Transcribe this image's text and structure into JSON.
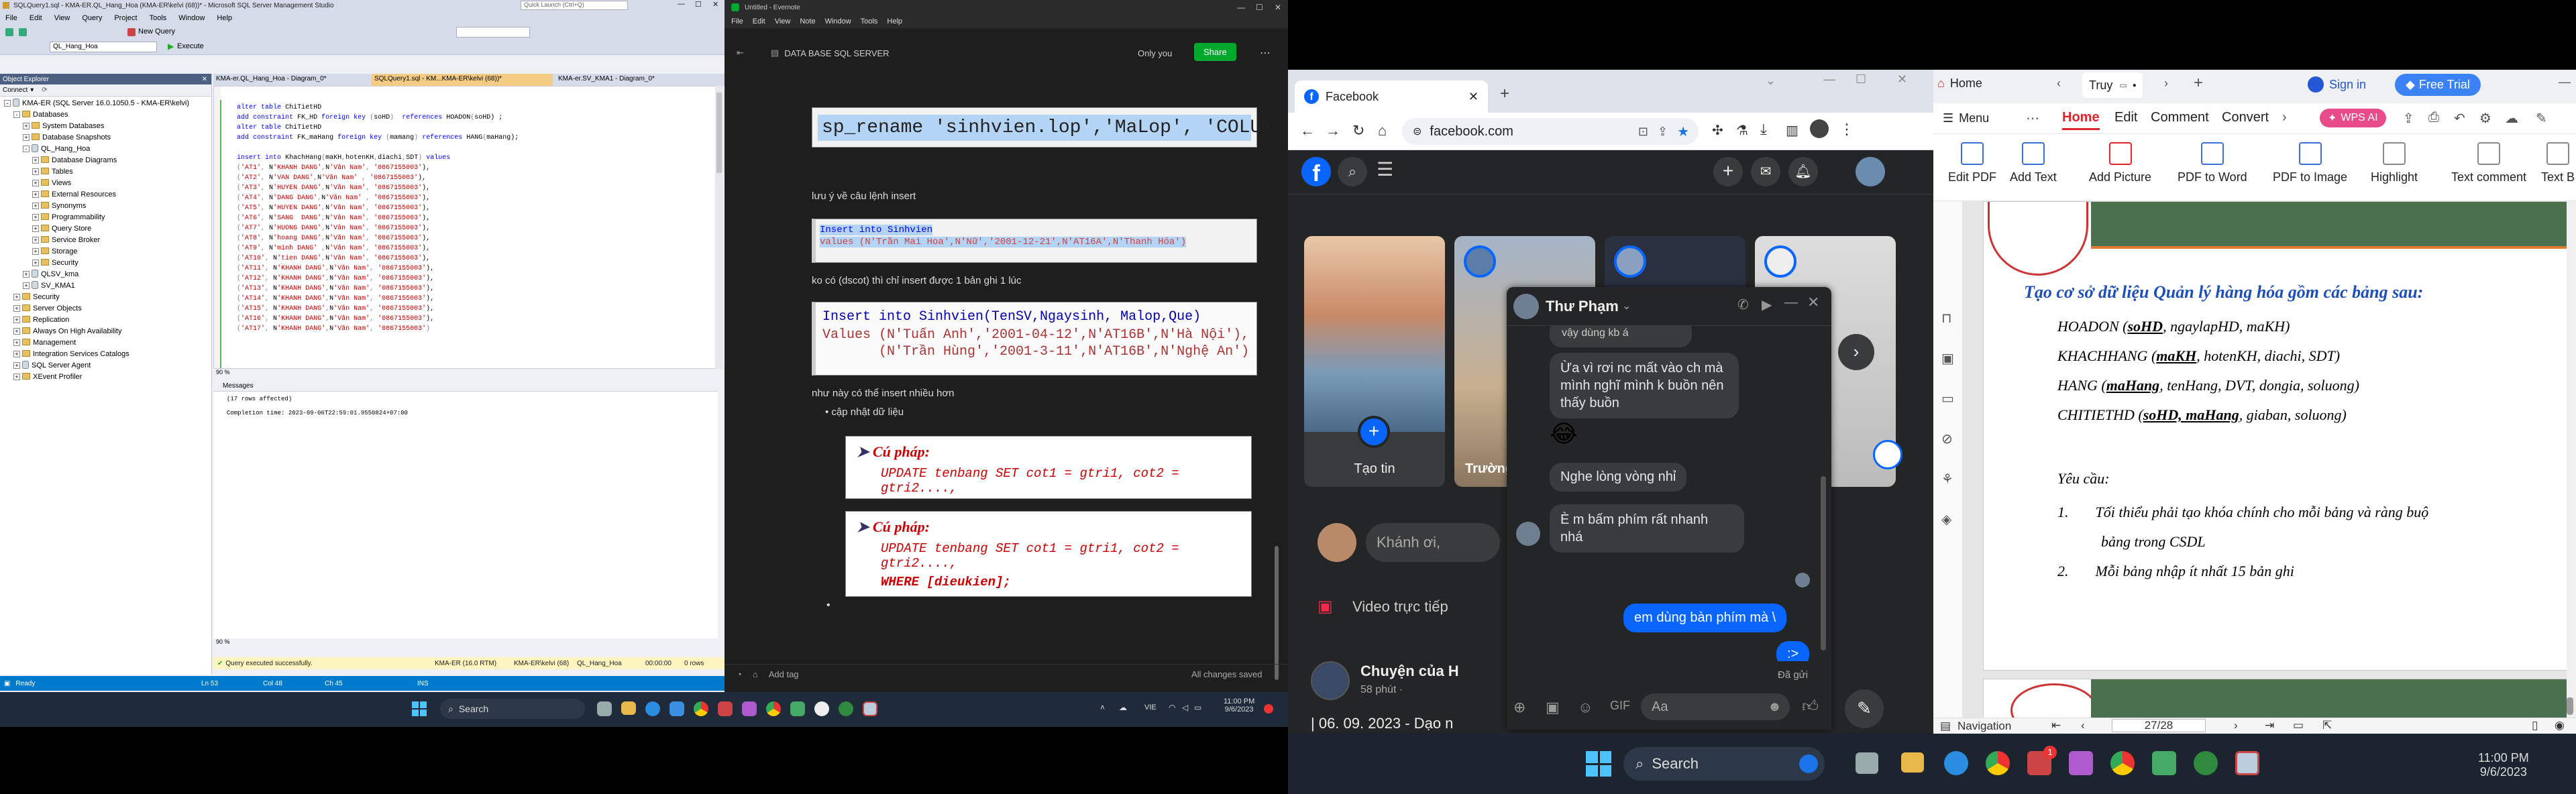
{
  "ssms": {
    "title": "SQLQuery1.sql - KMA-ER.QL_Hang_Hoa (KMA-ER\\kelvi (68))* - Microsoft SQL Server Management Studio",
    "quick_launch": "Quick Launch (Ctrl+Q)",
    "menu": [
      "File",
      "Edit",
      "View",
      "Query",
      "Project",
      "Tools",
      "Window",
      "Help"
    ],
    "toolbar": {
      "new_query": "New Query",
      "execute": "Execute",
      "database": "QL_Hang_Hoa"
    },
    "tabs": [
      "KMA-er.QL_Hang_Hoa - Diagram_0*",
      "SQLQuery1.sql - KM...KMA-ER\\kelvi (68))*",
      "KMA-er.SV_KMA1 - Diagram_0*"
    ],
    "object_explorer": {
      "title": "Object Explorer",
      "connect": "Connect",
      "items": [
        {
          "depth": 0,
          "sign": "-",
          "type": "server",
          "label": "KMA-ER (SQL Server 16.0.1050.5 - KMA-ER\\kelvi)"
        },
        {
          "depth": 1,
          "sign": "-",
          "type": "folder",
          "label": "Databases"
        },
        {
          "depth": 2,
          "sign": "+",
          "type": "folder",
          "label": "System Databases"
        },
        {
          "depth": 2,
          "sign": "+",
          "type": "folder",
          "label": "Database Snapshots"
        },
        {
          "depth": 2,
          "sign": "-",
          "type": "db",
          "label": "QL_Hang_Hoa"
        },
        {
          "depth": 3,
          "sign": "+",
          "type": "folder",
          "label": "Database Diagrams"
        },
        {
          "depth": 3,
          "sign": "+",
          "type": "folder",
          "label": "Tables"
        },
        {
          "depth": 3,
          "sign": "+",
          "type": "folder",
          "label": "Views"
        },
        {
          "depth": 3,
          "sign": "+",
          "type": "folder",
          "label": "External Resources"
        },
        {
          "depth": 3,
          "sign": "+",
          "type": "folder",
          "label": "Synonyms"
        },
        {
          "depth": 3,
          "sign": "+",
          "type": "folder",
          "label": "Programmability"
        },
        {
          "depth": 3,
          "sign": "+",
          "type": "folder",
          "label": "Query Store"
        },
        {
          "depth": 3,
          "sign": "+",
          "type": "folder",
          "label": "Service Broker"
        },
        {
          "depth": 3,
          "sign": "+",
          "type": "folder",
          "label": "Storage"
        },
        {
          "depth": 3,
          "sign": "+",
          "type": "folder",
          "label": "Security"
        },
        {
          "depth": 2,
          "sign": "+",
          "type": "db",
          "label": "QLSV_kma"
        },
        {
          "depth": 2,
          "sign": "+",
          "type": "db",
          "label": "SV_KMA1"
        },
        {
          "depth": 1,
          "sign": "+",
          "type": "folder",
          "label": "Security"
        },
        {
          "depth": 1,
          "sign": "+",
          "type": "folder",
          "label": "Server Objects"
        },
        {
          "depth": 1,
          "sign": "+",
          "type": "folder",
          "label": "Replication"
        },
        {
          "depth": 1,
          "sign": "+",
          "type": "folder",
          "label": "Always On High Availability"
        },
        {
          "depth": 1,
          "sign": "+",
          "type": "folder",
          "label": "Management"
        },
        {
          "depth": 1,
          "sign": "+",
          "type": "folder",
          "label": "Integration Services Catalogs"
        },
        {
          "depth": 1,
          "sign": "+",
          "type": "server",
          "label": "SQL Server Agent"
        },
        {
          "depth": 1,
          "sign": "+",
          "type": "folder",
          "label": "XEvent Profiler"
        }
      ]
    },
    "code": [
      "alter table ChiTietHD",
      "add constraint FK_HD foreign key (soHD)  references HOADON(soHD) ;",
      "alter table ChiTietHD",
      "add constraint FK_maHang foreign key (mamang) references HANG(maHang);",
      "",
      "insert into KhachHang(maKH,hotenKH,diachi,SDT) values",
      "('AT1', N'KHANH DANG',N'Văn Nam', '0867155003'),",
      "('AT2', N'VAN DANG',N'Văn Nam' , '0867155003'),",
      "('AT3', N'HUYEN DANG',N'Văn Nam', '0867155003'),",
      "('AT4', N'DANG DANG',N'Văn Nam' , '0867155003'),",
      "('AT5', N'HUYEN DANG',N'Văn Nam', '0867155003'),",
      "('AT6', N'SANG  DANG',N'Văn Nam', '0867155003'),",
      "('AT7', N'HUONG DANG',N'Văn Nam', '0867155003'),",
      "('AT8', N'hoang DANG',N'Văn Nam', '0867155003'),",
      "('AT9', N'minh DANG' ,N'Văn Nam', '0867155003'),",
      "('AT10', N'tien DANG',N'Văn Nam', '0867155003'),",
      "('AT11', N'KHANH DANG',N'Văn Nam', '0867155003'),",
      "('AT12', N'KHANH DANG',N'Văn Nam', '0867155003'),",
      "('AT13', N'KHANH DANG',N'Văn Nam', '0867155003'),",
      "('AT14', N'KHANH DANG',N'Văn Nam', '0867155003'),",
      "('AT15', N'KHANH DANG',N'Văn Nam', '0867155003'),",
      "('AT16', N'KHANH DANG',N'Văn Nam', '0867155003'),",
      "('AT17', N'KHANH DANG',N'Văn Nam', '0867155003')"
    ],
    "zoom": "90 %",
    "messages_tab": "Messages",
    "messages": [
      "(17 rows affected)",
      "",
      "Completion time: 2023-09-06T22:59:01.9550824+07:00"
    ],
    "status_ok": "Query executed successfully.",
    "status_server": "KMA-ER (16.0 RTM)",
    "status_user": "KMA-ER\\kelvi (68)",
    "status_db": "QL_Hang_Hoa",
    "status_time": "00:00:00",
    "status_rows": "0 rows",
    "bottom": {
      "ready": "Ready",
      "ln": "Ln 53",
      "col": "Col 48",
      "ch": "Ch 45",
      "ins": "INS"
    }
  },
  "taskbar_left": {
    "search": "Search",
    "time": "11:00 PM",
    "date": "9/6/2023",
    "lang": "VIE"
  },
  "evernote": {
    "title": "Untitled - Evernote",
    "menu": [
      "File",
      "Edit",
      "View",
      "Note",
      "Window",
      "Tools",
      "Help"
    ],
    "notebook": "DATA BASE SQL SERVER",
    "only_you": "Only you",
    "share": "Share",
    "code1": "sp_rename 'sinhvien.lop','MaLop', 'COLUMN'",
    "note1": "lưu ý về câu lệnh insert",
    "code2a": "Insert into Sinhvien",
    "code2b": "values (N'Trần Mai Hoa',N'Nữ','2001-12-21',N'AT16A',N'Thanh Hóa')",
    "note2": "ko có (dscot) thì chỉ insert được 1 bản ghi 1 lúc",
    "code3a": "Insert into Sinhvien(TenSV,Ngaysinh, Malop,Que)",
    "code3b": "Values (N'Tuấn Anh','2001-04-12',N'AT16B',N'Hà Nội'),",
    "code3c": "       (N'Trần Hùng','2001-3-11',N'AT16B',N'Nghệ An')",
    "note3": "như này có thể insert nhiều hơn",
    "bullet": "cập nhật dữ liệu",
    "syntax_label": "Cú pháp:",
    "syntax1": "UPDATE tenbang SET cot1 = gtri1, cot2 = gtri2....,",
    "syntax2a": "UPDATE tenbang SET cot1 = gtri1, cot2 = gtri2....,",
    "syntax2b": "WHERE [dieukien];",
    "add_tag": "Add tag",
    "saved": "All changes saved"
  },
  "facebook": {
    "tab": "Facebook",
    "url": "facebook.com",
    "story_create": "Tạo tin",
    "story_2": "Trường",
    "composer_placeholder": "Khánh ơi,",
    "live_video": "Video trực tiếp",
    "post_author": "Chuyện của H",
    "post_meta": "58 phút ·",
    "post_text": "| 06. 09. 2023 - Dạo n"
  },
  "messenger": {
    "name": "Thư Phạm",
    "msgs": [
      {
        "side": "in",
        "text": "vậy dùng kb á"
      },
      {
        "side": "in",
        "text": "Ừa vì rơi nc mất vào ch mà mình nghĩ mình k buồn nên thấy buồn"
      },
      {
        "side": "in",
        "text": "😂"
      },
      {
        "side": "in",
        "text": "Nghe lòng vòng nhỉ"
      },
      {
        "side": "in",
        "text": "È m bấm phím rất nhanh nhá"
      },
      {
        "side": "out",
        "text": "em dùng bàn phím mà \\"
      },
      {
        "side": "out",
        "text": ":>"
      }
    ],
    "sent": "Đã gửi",
    "input_placeholder": "Aa"
  },
  "pdf": {
    "tab_home": "Home",
    "tab_2": "Truy",
    "signin": "Sign in",
    "trial": "Free Trial",
    "menu": "Menu",
    "ribbon_tabs": [
      "Home",
      "Edit",
      "Comment",
      "Convert"
    ],
    "wps_ai": "WPS AI",
    "tools": [
      "Edit PDF",
      "Add Text",
      "Add Picture",
      "PDF to Word",
      "PDF to Image",
      "Highlight",
      "Text comment",
      "Text B"
    ],
    "heading": "Tạo cơ sở dữ liệu Quản lý hàng hóa gồm các bảng sau:",
    "tables": [
      {
        "name": "HOADON",
        "keys": "soHD",
        "rest": ", ngaylapHD, maKH)"
      },
      {
        "name": "KHACHHANG",
        "keys": "maKH",
        "rest": ", hotenKH, diachi, SDT)"
      },
      {
        "name": "HANG",
        "keys": "maHang",
        "rest": ", tenHang, DVT, dongia, soluong)"
      },
      {
        "name": "CHITIETHD",
        "keys": "soHD, maHang",
        "rest": ", giaban, soluong)"
      }
    ],
    "req_title": "Yêu cầu:",
    "req": [
      "Tối thiểu phải tạo khóa chính cho mỗi bảng và ràng buộ",
      "bảng trong CSDL",
      "Mỗi bảng nhập ít nhất 15 bản ghi"
    ],
    "nav": "Navigation",
    "page": "27/28"
  },
  "taskbar_right": {
    "search": "Search",
    "time": "11:00 PM",
    "date": "9/6/2023",
    "badge": "1"
  },
  "colors": {
    "fb_blue": "#0866ff",
    "wps_red": "#e0242b",
    "share_green": "#00a82d",
    "ssms_blue": "#007acc"
  }
}
